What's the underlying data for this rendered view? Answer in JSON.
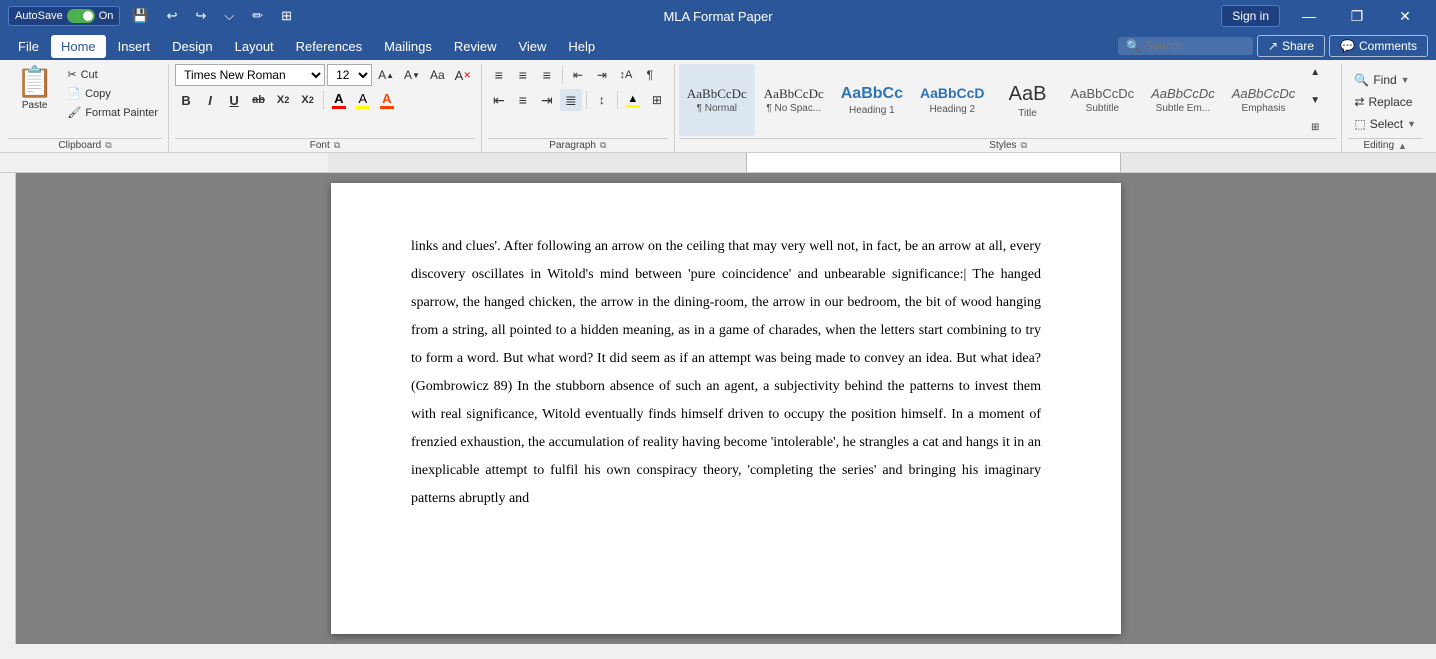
{
  "titleBar": {
    "autosave_label": "AutoSave",
    "autosave_state": "On",
    "title": "MLA Format Paper",
    "signin_label": "Sign in",
    "undo_icon": "↩",
    "redo_icon": "↪",
    "more_icon": "⌵",
    "save_icon": "💾",
    "pen_icon": "✏",
    "layout_icon": "⊞",
    "minimize": "—",
    "restore": "❐",
    "close": "✕"
  },
  "menuBar": {
    "items": [
      {
        "label": "File",
        "active": false
      },
      {
        "label": "Home",
        "active": true
      },
      {
        "label": "Insert",
        "active": false
      },
      {
        "label": "Design",
        "active": false
      },
      {
        "label": "Layout",
        "active": false
      },
      {
        "label": "References",
        "active": false
      },
      {
        "label": "Mailings",
        "active": false
      },
      {
        "label": "Review",
        "active": false
      },
      {
        "label": "View",
        "active": false
      },
      {
        "label": "Help",
        "active": false
      }
    ],
    "search_placeholder": "Search",
    "share_label": "Share",
    "comments_label": "Comments"
  },
  "ribbon": {
    "clipboard": {
      "label": "Clipboard",
      "paste_label": "Paste",
      "cut_label": "Cut",
      "copy_label": "Copy",
      "format_painter_label": "Format Painter"
    },
    "font": {
      "label": "Font",
      "font_name": "Times New Rom",
      "font_size": "12",
      "grow_icon": "A↑",
      "shrink_icon": "A↓",
      "case_icon": "Aa",
      "more_icon": "A",
      "clear_icon": "A✕",
      "bold": "B",
      "italic": "I",
      "underline": "U",
      "strikethrough": "ab",
      "subscript": "X₂",
      "superscript": "X²",
      "font_color_label": "A",
      "highlight_label": "A",
      "text_color_label": "A"
    },
    "paragraph": {
      "label": "Paragraph",
      "bullets_icon": "≡",
      "numbering_icon": "≡",
      "multilevel_icon": "≡",
      "decrease_indent": "⇤",
      "increase_indent": "⇥",
      "sort_icon": "↕A",
      "show_marks": "¶",
      "align_left": "≡",
      "align_center": "≡",
      "align_right": "≡",
      "align_justify": "≡",
      "line_spacing": "↕",
      "shading_icon": "▲",
      "border_icon": "⊞"
    },
    "styles": {
      "label": "Styles",
      "items": [
        {
          "preview": "Normal",
          "label": "¶ Normal",
          "active": true
        },
        {
          "preview": "No Spac...",
          "label": "¶ No Spac...",
          "active": false
        },
        {
          "preview": "Heading 1",
          "label": "Heading 1",
          "active": false,
          "style": "h1"
        },
        {
          "preview": "Heading 2",
          "label": "Heading 2",
          "active": false,
          "style": "h2"
        },
        {
          "preview": "Title",
          "label": "Title",
          "active": false,
          "style": "title"
        },
        {
          "preview": "Subtitle",
          "label": "Subtitle",
          "active": false,
          "style": "subtitle"
        },
        {
          "preview": "Subtle Em...",
          "label": "Subtle Em...",
          "active": false
        },
        {
          "preview": "Emphasis",
          "label": "Emphasis",
          "active": false
        }
      ],
      "expand_label": "▼"
    },
    "editing": {
      "label": "Editing",
      "find_label": "Find",
      "replace_label": "Replace",
      "select_label": "Select"
    }
  },
  "document": {
    "content": "links and clues'. After following an arrow on the ceiling that may very well not, in fact, be an arrow at all, every discovery oscillates in Witold's mind between 'pure coincidence' and unbearable significance: The hanged sparrow, the hanged chicken, the arrow in the dining-room, the arrow in our bedroom, the bit of wood hanging from a string, all pointed to a hidden meaning, as in a game of charades, when the letters start combining to try to form a word. But what word? It did seem as if an attempt was being made to convey an idea. But what idea? (Gombrowicz 89) In the stubborn absence of such an agent, a subjectivity behind the patterns to invest them with real significance, Witold eventually finds himself driven to occupy the position himself. In a moment of frenzied exhaustion, the accumulation of reality having become 'intolerable', he strangles a cat and hangs it in an inexplicable attempt to fulfil his own conspiracy theory, 'completing the series' and bringing his imaginary patterns abruptly and"
  }
}
